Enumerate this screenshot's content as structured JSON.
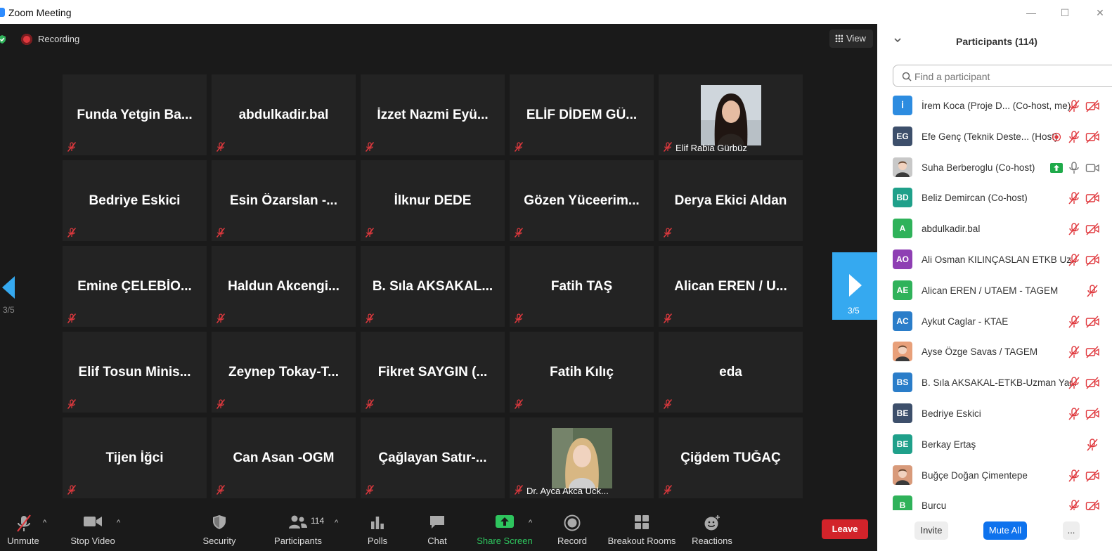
{
  "window": {
    "title": "Zoom Meeting",
    "minimize": "—",
    "maximize": "☐",
    "close": "✕"
  },
  "meeting": {
    "recording_label": "Recording",
    "view_label": "View",
    "page_left": "3/5",
    "page_right": "3/5",
    "tiles": [
      {
        "name": "Funda Yetgin Ba..."
      },
      {
        "name": "abdulkadir.bal"
      },
      {
        "name": "İzzet Nazmi Eyü..."
      },
      {
        "name": "ELİF DİDEM GÜ..."
      },
      {
        "name": "",
        "caption": "Elif Rabia Gürbüz",
        "photo": "woman-dark-hair"
      },
      {
        "name": "Bedriye Eskici"
      },
      {
        "name": "Esin Özarslan -..."
      },
      {
        "name": "İlknur  DEDE"
      },
      {
        "name": "Gözen Yüceerim..."
      },
      {
        "name": "Derya Ekici Aldan"
      },
      {
        "name": "Emine  ÇELEBİO..."
      },
      {
        "name": "Haldun Akcengi..."
      },
      {
        "name": "B. Sıla AKSAKAL..."
      },
      {
        "name": "Fatih TAŞ"
      },
      {
        "name": "Alican EREN / U..."
      },
      {
        "name": "Elif Tosun Minis..."
      },
      {
        "name": "Zeynep Tokay-T..."
      },
      {
        "name": "Fikret SAYGIN (..."
      },
      {
        "name": "Fatih Kılıç"
      },
      {
        "name": "eda"
      },
      {
        "name": "Tijen İğci"
      },
      {
        "name": "Can Asan -OGM"
      },
      {
        "name": "Çağlayan  Satır-..."
      },
      {
        "name": "",
        "caption": "Dr. Ayca Akca Uck...",
        "photo": "woman-blonde-hair"
      },
      {
        "name": "Çiğdem TUĞAÇ"
      }
    ]
  },
  "toolbar": {
    "unmute": "Unmute",
    "stop_video": "Stop Video",
    "security": "Security",
    "participants": "Participants",
    "participants_count": "114",
    "polls": "Polls",
    "chat": "Chat",
    "share_screen": "Share Screen",
    "record": "Record",
    "breakout_rooms": "Breakout Rooms",
    "reactions": "Reactions",
    "leave": "Leave",
    "caret": "^"
  },
  "panel": {
    "title": "Participants (114)",
    "search_placeholder": "Find a participant",
    "participants": [
      {
        "initials": "İ",
        "color": "#2d8ce0",
        "name": "İrem Koca (Proje D...  (Co-host, me)",
        "audio": "muted",
        "video": "off"
      },
      {
        "initials": "EG",
        "color": "#3d4f6b",
        "name": "Efe Genç (Teknik Deste...  (Host)",
        "audio": "muted",
        "video": "off",
        "recording": true
      },
      {
        "initials": "",
        "color": "#c8c8c8",
        "name": "Suha Berberoglu (Co-host)",
        "audio": "on",
        "video": "on",
        "sharing": true,
        "photo": true
      },
      {
        "initials": "BD",
        "color": "#1fa08a",
        "name": "Beliz Demircan (Co-host)",
        "audio": "muted",
        "video": "off"
      },
      {
        "initials": "A",
        "color": "#2fb25a",
        "name": "abdulkadir.bal",
        "audio": "muted",
        "video": "off"
      },
      {
        "initials": "AO",
        "color": "#8e3fb3",
        "name": "Ali Osman KILINÇASLAN ETKB Uz...",
        "audio": "muted",
        "video": "off"
      },
      {
        "initials": "AE",
        "color": "#2fb25a",
        "name": "Alican EREN / UTAEM - TAGEM",
        "audio": "muted",
        "video": "none"
      },
      {
        "initials": "AC",
        "color": "#2a7dc9",
        "name": "Aykut Caglar - KTAE",
        "audio": "muted",
        "video": "off"
      },
      {
        "initials": "",
        "color": "#e8a07a",
        "name": "Ayse Özge Savas / TAGEM",
        "audio": "muted",
        "video": "off",
        "photo": true
      },
      {
        "initials": "BS",
        "color": "#2a7dc9",
        "name": "B. Sıla AKSAKAL-ETKB-Uzman Yar...",
        "audio": "muted",
        "video": "off"
      },
      {
        "initials": "BE",
        "color": "#3d4f6b",
        "name": "Bedriye Eskici",
        "audio": "muted",
        "video": "off"
      },
      {
        "initials": "BE",
        "color": "#1fa08a",
        "name": "Berkay Ertaş",
        "audio": "muted",
        "video": "none"
      },
      {
        "initials": "",
        "color": "#d89a7a",
        "name": "Buğçe Doğan Çimentepe",
        "audio": "muted",
        "video": "off",
        "photo": true
      },
      {
        "initials": "B",
        "color": "#2fb25a",
        "name": "Burcu",
        "audio": "muted",
        "video": "off"
      }
    ],
    "invite": "Invite",
    "mute_all": "Mute All",
    "more": "..."
  }
}
